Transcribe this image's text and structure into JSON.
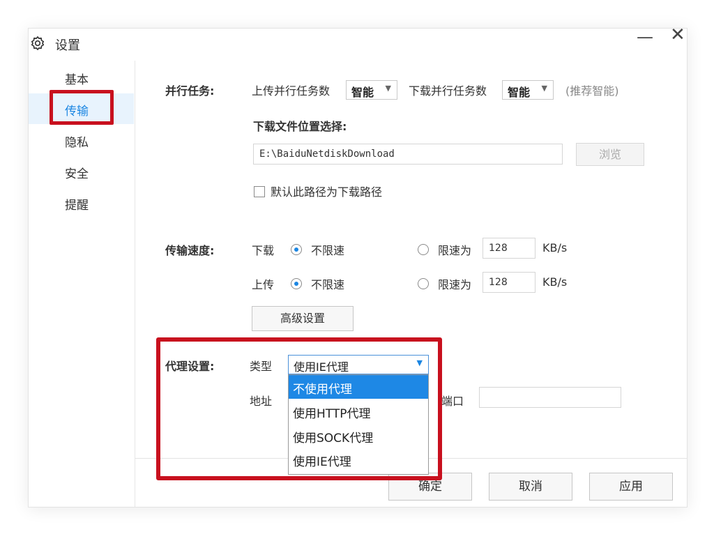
{
  "window": {
    "title": "设置",
    "minimize": "—",
    "close": "✕"
  },
  "sidebar": {
    "items": [
      {
        "label": "基本"
      },
      {
        "label": "传输"
      },
      {
        "label": "隐私"
      },
      {
        "label": "安全"
      },
      {
        "label": "提醒"
      }
    ],
    "active_index": 1
  },
  "parallel": {
    "label": "并行任务:",
    "upload_label": "上传并行任务数",
    "upload_value": "智能",
    "download_label": "下载并行任务数",
    "download_value": "智能",
    "hint": "(推荐智能)"
  },
  "download_path": {
    "label": "下载文件位置选择:",
    "value": "E:\\BaiduNetdiskDownload",
    "browse": "浏览",
    "default_checkbox": "默认此路径为下载路径",
    "default_checked": false
  },
  "speed": {
    "label": "传输速度:",
    "download_label": "下载",
    "upload_label": "上传",
    "unlimited": "不限速",
    "limit_to": "限速为",
    "download_limit": "128",
    "upload_limit": "128",
    "unit": "KB/s",
    "advanced": "高级设置"
  },
  "proxy": {
    "label": "代理设置:",
    "type_label": "类型",
    "type_value": "使用IE代理",
    "address_label": "地址",
    "port_label": "端口",
    "options": [
      "不使用代理",
      "使用HTTP代理",
      "使用SOCK代理",
      "使用IE代理"
    ],
    "highlighted_index": 0
  },
  "footer": {
    "ok": "确定",
    "cancel": "取消",
    "apply": "应用"
  },
  "colors": {
    "accent": "#1c86e2",
    "highlight_box": "#c8101e"
  }
}
